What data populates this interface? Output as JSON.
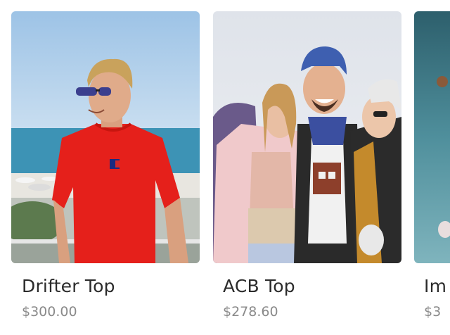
{
  "products": [
    {
      "name": "Drifter Top",
      "price": "$300.00",
      "image": "man-red-tshirt-beach-photo"
    },
    {
      "name": "ACB Top",
      "price": "$278.60",
      "image": "friends-winter-clothes-photo"
    },
    {
      "name": "Im",
      "price": "$3",
      "image": "teal-partial-photo"
    }
  ]
}
